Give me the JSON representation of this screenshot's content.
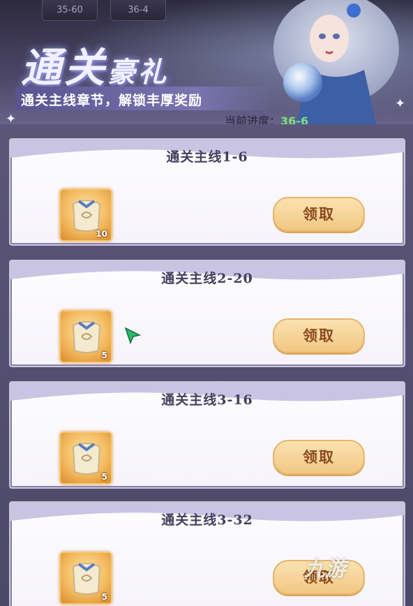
{
  "header": {
    "top_tabs": [
      "35-60",
      "36-4"
    ],
    "title_main": "通关",
    "title_rest": "豪礼",
    "subtitle": "通关主线章节，解锁丰厚奖励",
    "progress_label": "当前进度：",
    "progress_value": "36-6"
  },
  "cards": [
    {
      "title": "通关主线1-6",
      "reward_count": "10",
      "claim_label": "领取"
    },
    {
      "title": "通关主线2-20",
      "reward_count": "5",
      "claim_label": "领取"
    },
    {
      "title": "通关主线3-16",
      "reward_count": "5",
      "claim_label": "领取"
    },
    {
      "title": "通关主线3-32",
      "reward_count": "5",
      "claim_label": "领取"
    }
  ],
  "icons": {
    "reward": "scroll-pouch-icon",
    "cursor": "green-cursor-icon",
    "watermark": "watermark-logo"
  },
  "watermark": "九游",
  "colors": {
    "panel": "#5b5679",
    "claim_button": "#f1c783",
    "progress_value": "#7ee07a"
  }
}
